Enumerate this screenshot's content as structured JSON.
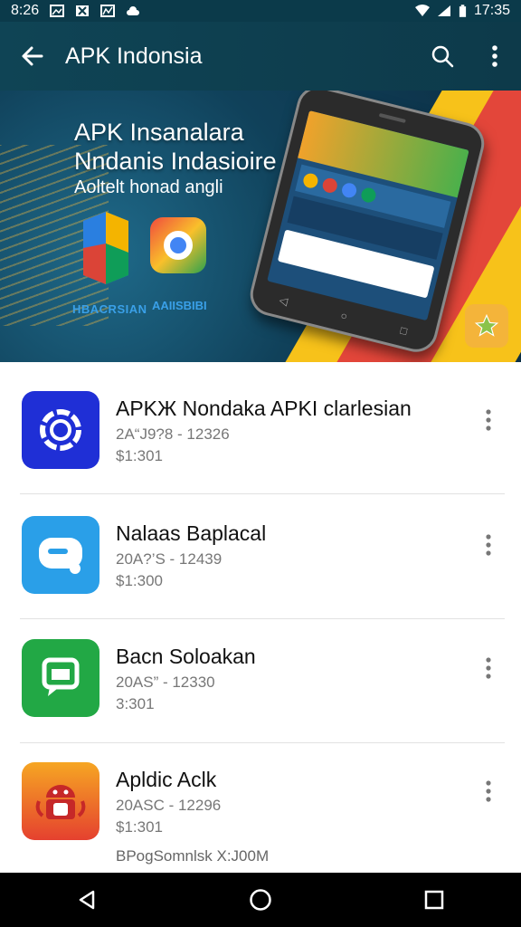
{
  "status_bar": {
    "time_left": "8:26",
    "time_right": "17:35"
  },
  "app_bar": {
    "title": "APK Indonsia"
  },
  "banner": {
    "heading_line1": "APK Insanalara",
    "heading_line2": "Nndanis Indasioire",
    "subheading": "Aoltelt honad angli",
    "app_label_1": "HBACRSIAN",
    "app_label_2": "AAIISBIBI"
  },
  "apps": [
    {
      "name": "APKЖ Nondaka APKI clarlesian",
      "meta1": "2А“J9?8 - 12326",
      "meta2": "$1:301",
      "icon_color": "#1f2fd6"
    },
    {
      "name": "Nalaas Baplacal",
      "meta1": "20А?’S - 12439",
      "meta2": "$1:300",
      "icon_color": "#2a9fe8"
    },
    {
      "name": "Bacn Soloakan",
      "meta1": "20АS” - 12330",
      "meta2": "3:301",
      "icon_color": "#22a845"
    },
    {
      "name": "Apldic Aclk",
      "meta1": "20АSC - 12296",
      "meta2": "$1:301",
      "icon_color": "#e5412f"
    }
  ],
  "footnote": "BPogSomnlsk X:J00M",
  "colors": {
    "app_bar": "#0f4455",
    "status_bar": "#0b3a4a",
    "nav_bar": "#000000"
  },
  "icons": {
    "back": "arrow-left-icon",
    "search": "search-icon",
    "overflow": "more-vert-icon",
    "nav_back": "triangle-back-icon",
    "nav_home": "circle-home-icon",
    "nav_recents": "square-recents-icon"
  }
}
